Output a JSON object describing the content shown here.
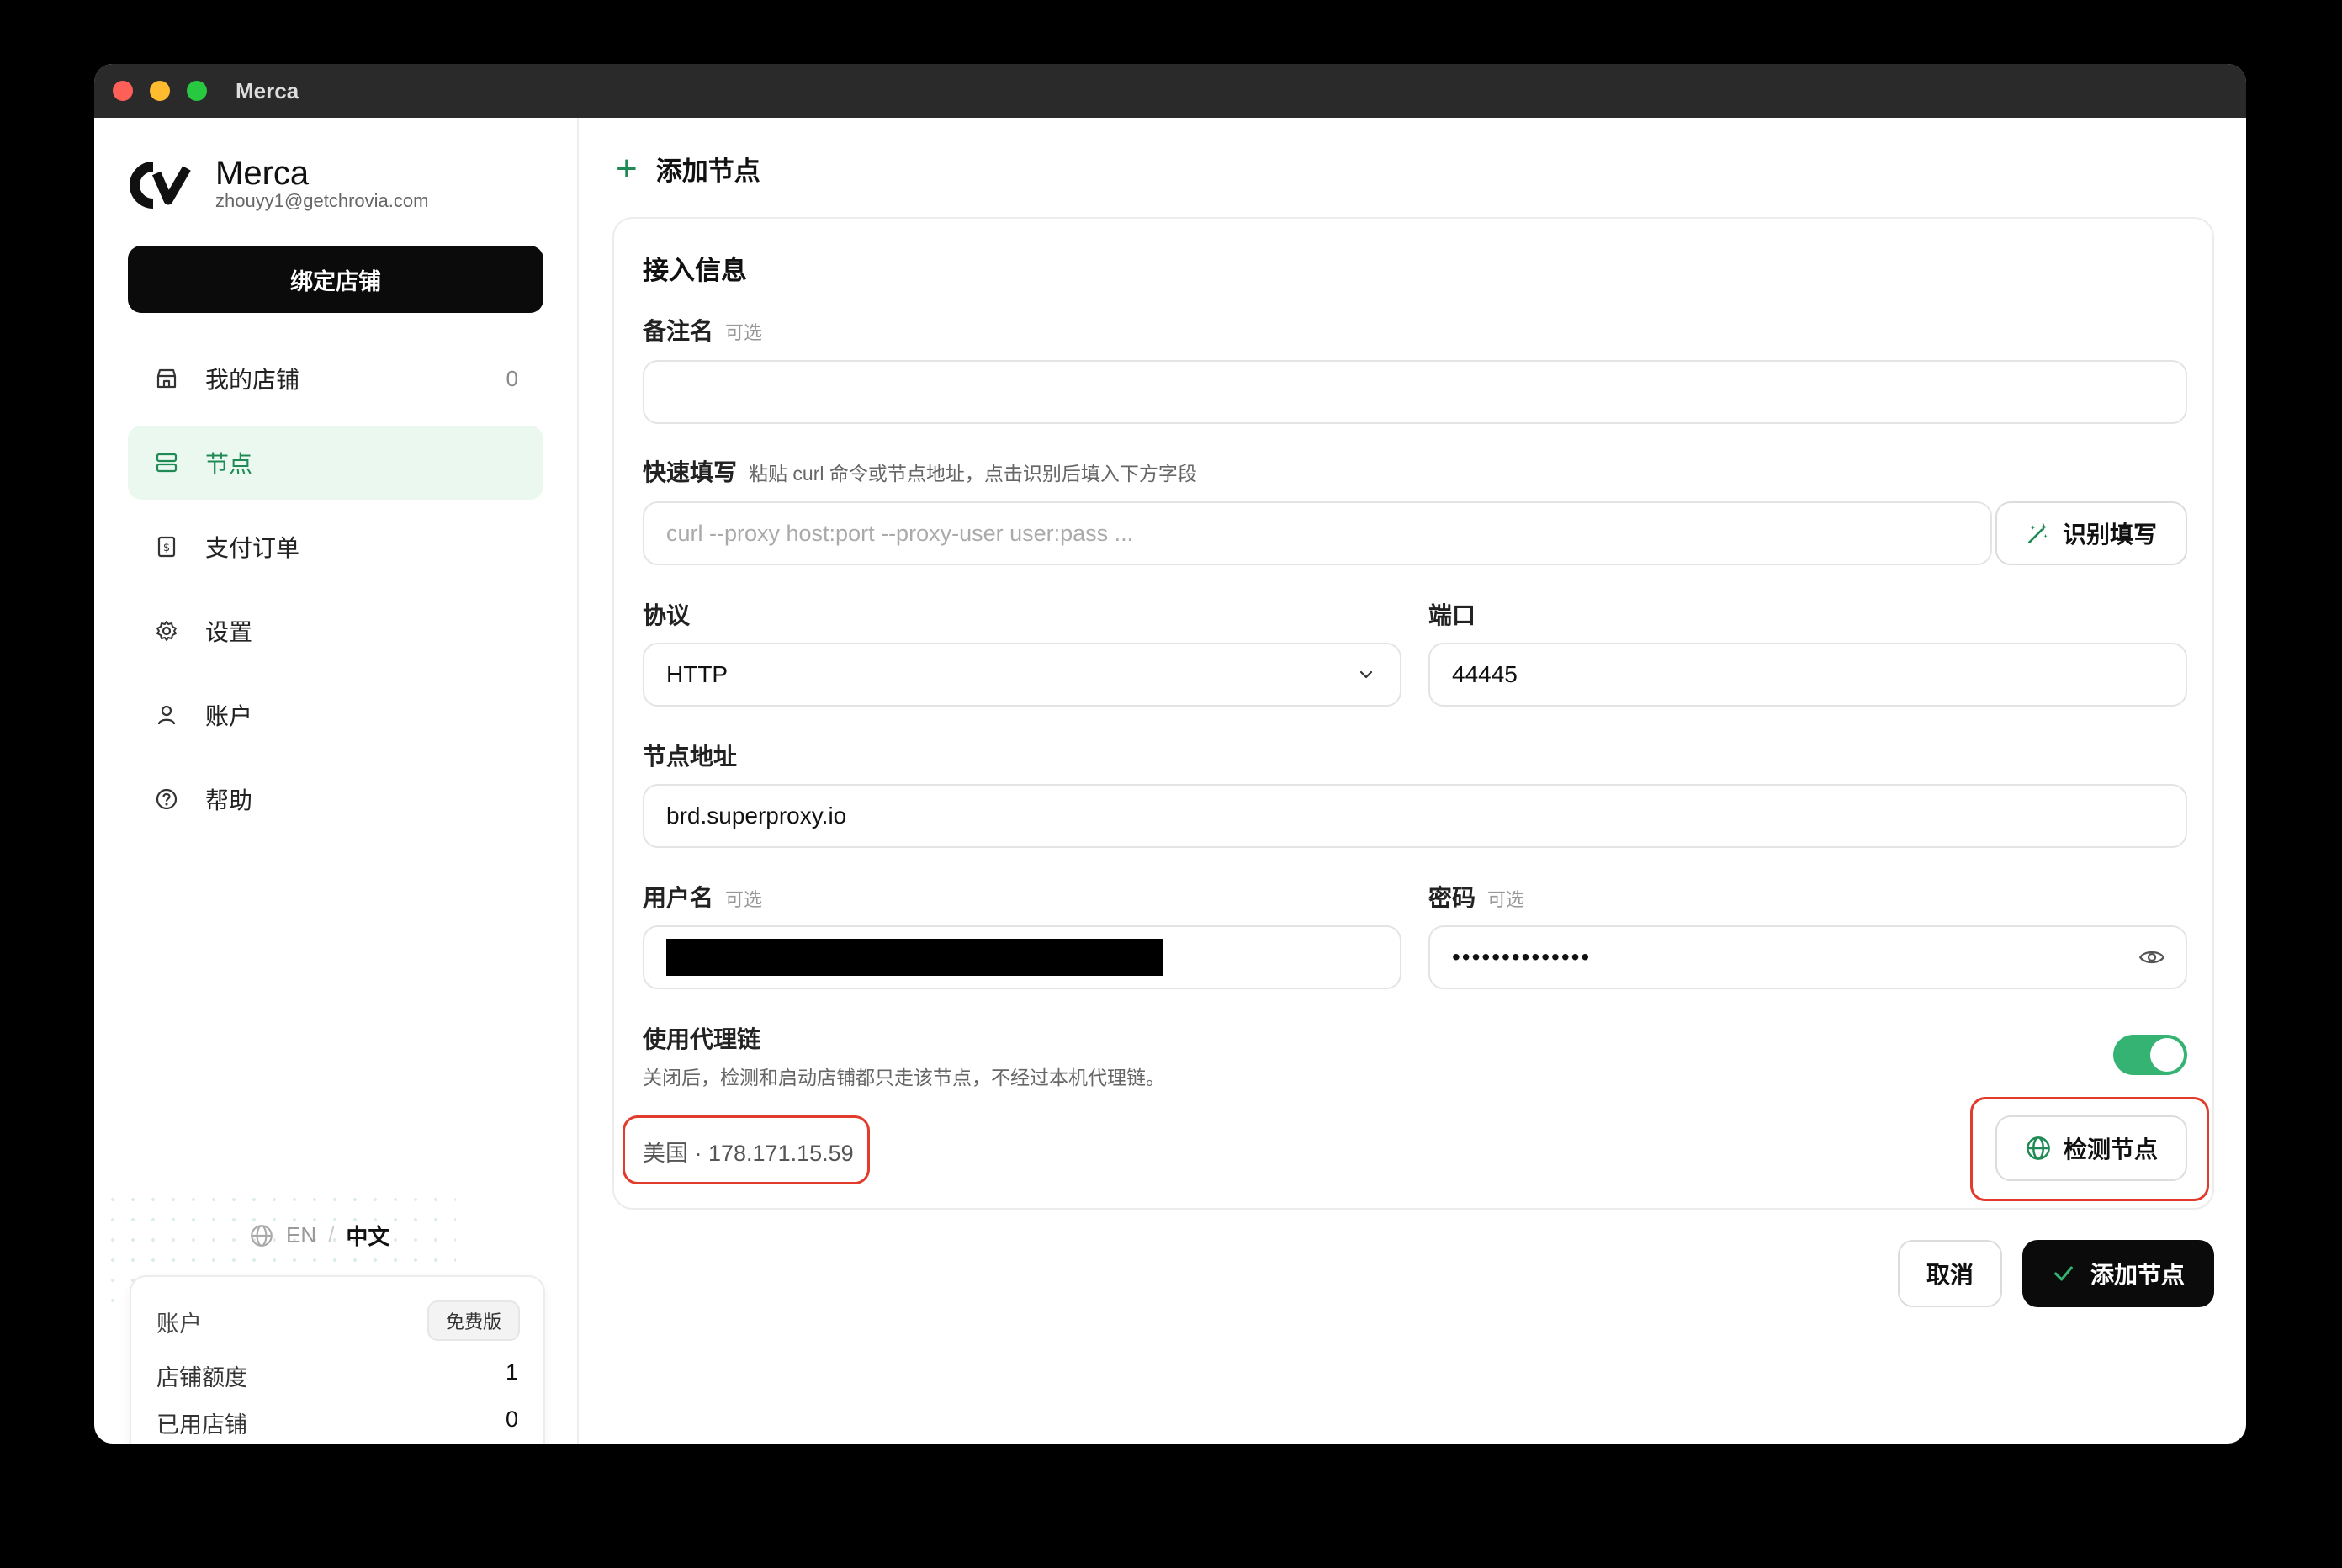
{
  "window": {
    "title": "Merca"
  },
  "sidebar": {
    "brand": "Merca",
    "email": "zhouyy1@getchrovia.com",
    "bind_button": "绑定店铺",
    "items": [
      {
        "label": "我的店铺",
        "count": "0",
        "icon": "store-icon"
      },
      {
        "label": "节点",
        "icon": "server-icon",
        "active": true
      },
      {
        "label": "支付订单",
        "icon": "receipt-icon"
      },
      {
        "label": "设置",
        "icon": "gear-icon"
      },
      {
        "label": "账户",
        "icon": "user-icon"
      },
      {
        "label": "帮助",
        "icon": "help-circle-icon"
      }
    ],
    "language": {
      "en": "EN",
      "separator": "/",
      "zh": "中文"
    },
    "account_card": {
      "title": "账户",
      "plan_badge": "免费版",
      "rows": [
        {
          "label": "店铺额度",
          "value": "1"
        },
        {
          "label": "已用店铺",
          "value": "0"
        }
      ]
    }
  },
  "main": {
    "header": {
      "icon": "+",
      "title": "添加节点"
    },
    "section_title": "接入信息",
    "fields": {
      "remark": {
        "label": "备注名",
        "optional": "可选",
        "value": ""
      },
      "quick_fill": {
        "label": "快速填写",
        "hint": "粘贴 curl 命令或节点地址，点击识别后填入下方字段",
        "placeholder": "curl --proxy host:port --proxy-user user:pass ...",
        "button": "识别填写"
      },
      "protocol": {
        "label": "协议",
        "value": "HTTP"
      },
      "port": {
        "label": "端口",
        "value": "44445"
      },
      "address": {
        "label": "节点地址",
        "value": "brd.superproxy.io"
      },
      "username": {
        "label": "用户名",
        "optional": "可选"
      },
      "password": {
        "label": "密码",
        "optional": "可选",
        "value": "••••••••••••••"
      },
      "proxy_chain": {
        "label": "使用代理链",
        "description": "关闭后，检测和启动店铺都只走该节点，不经过本机代理链。",
        "enabled": true
      }
    },
    "geo_result": "美国 · 178.171.15.59",
    "detect_button": "检测节点",
    "cancel_button": "取消",
    "submit_button": "添加节点"
  },
  "colors": {
    "accent_green": "#1f8a55",
    "toggle_green": "#34b372",
    "highlight_red": "#e23b2c",
    "primary_black": "#0b0b0b"
  }
}
